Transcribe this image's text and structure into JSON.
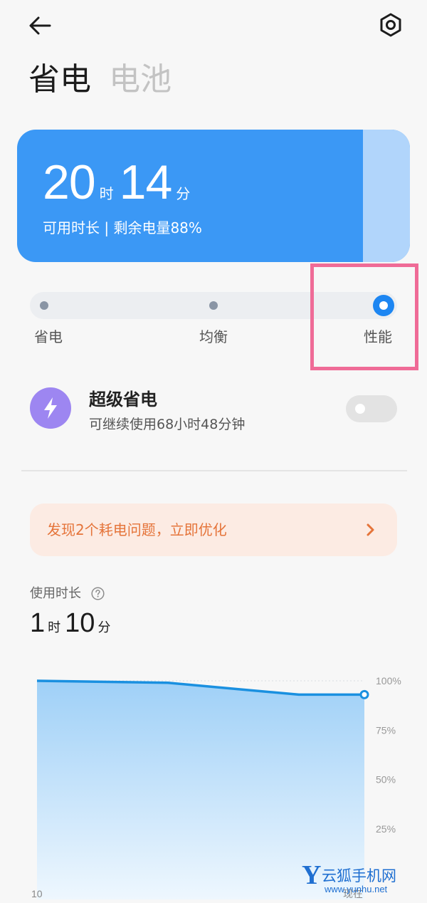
{
  "header": {
    "back_icon": "arrow-left-icon",
    "settings_icon": "hexagon-gear-icon",
    "tabs": [
      {
        "label": "省电",
        "active": true
      },
      {
        "label": "电池",
        "active": false
      }
    ]
  },
  "battery": {
    "hours": "20",
    "hours_unit": "时",
    "minutes": "14",
    "minutes_unit": "分",
    "subtitle": "可用时长 | 剩余电量88%",
    "level_percent": 88,
    "color": "#3b98f5"
  },
  "modes": {
    "items": [
      {
        "label": "省电"
      },
      {
        "label": "均衡"
      },
      {
        "label": "性能"
      }
    ],
    "selected": "性能",
    "accent": "#1d86f2"
  },
  "super_saver": {
    "icon": "lightning-icon",
    "title": "超级省电",
    "subtitle": "可继续使用68小时48分钟",
    "enabled": false
  },
  "issue_banner": {
    "text": "发现2个耗电问题，立即优化",
    "color": "#e5743a"
  },
  "usage": {
    "label": "使用时长",
    "hours": "1",
    "hours_unit": "时",
    "minutes": "10",
    "minutes_unit": "分"
  },
  "chart_data": {
    "type": "area",
    "x_start_label": "10",
    "x_end_label": "现在",
    "y_ticks": [
      "100%",
      "75%",
      "50%",
      "25%"
    ],
    "ylim": [
      0,
      100
    ],
    "x": [
      0,
      40,
      60,
      80,
      100
    ],
    "values": [
      100,
      99,
      96,
      93,
      93
    ],
    "grid": true
  },
  "watermark": {
    "logo_text": "云狐手机网",
    "url": "www.yunhu.net"
  }
}
